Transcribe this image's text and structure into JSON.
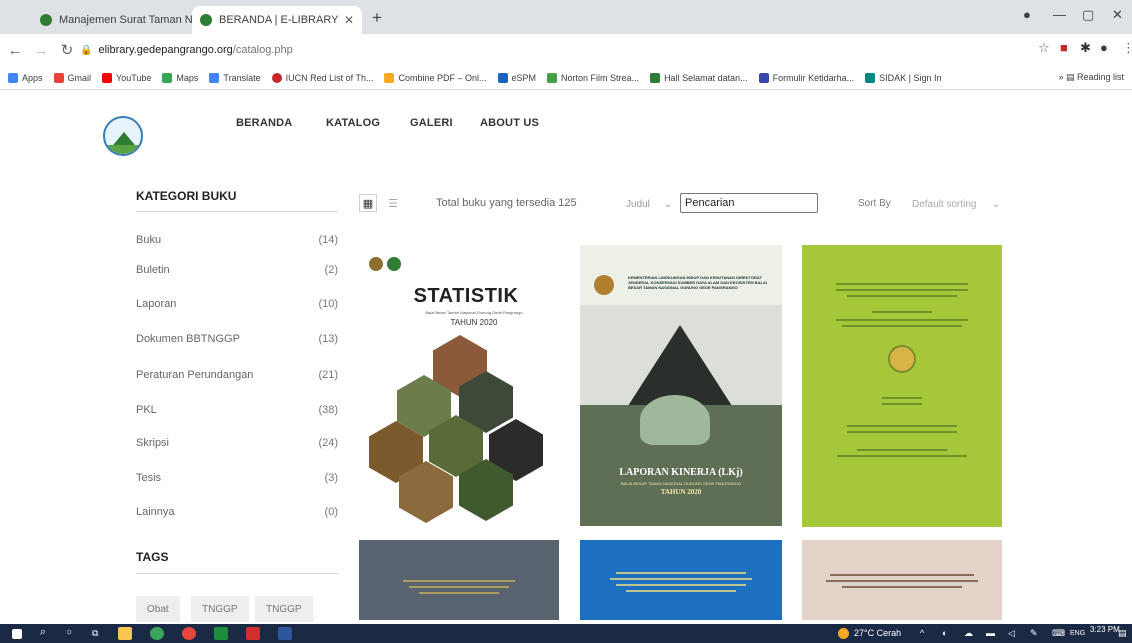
{
  "browser": {
    "tabs": [
      {
        "title": "Manajemen Surat Taman Nasior",
        "active": false
      },
      {
        "title": "BERANDA | E-LIBRARY",
        "active": true
      }
    ],
    "url_host": "elibrary.gedepangrango.org",
    "url_path": "/catalog.php",
    "bookmarks": [
      "Apps",
      "Gmail",
      "YouTube",
      "Maps",
      "Translate",
      "IUCN Red List of Th...",
      "Combine PDF – Onl...",
      "eSPM",
      "Norton Film Strea...",
      "Hall Selamat datan...",
      "Formulir Ketidarha...",
      "SIDAK | Sign In"
    ],
    "reading_list": "Reading list"
  },
  "site": {
    "nav": [
      "BERANDA",
      "KATALOG",
      "GALERI",
      "ABOUT US"
    ]
  },
  "sidebar": {
    "category_title": "KATEGORI BUKU",
    "categories": [
      {
        "name": "Buku",
        "count": "(14)"
      },
      {
        "name": "Buletin",
        "count": "(2)"
      },
      {
        "name": "Laporan",
        "count": "(10)"
      },
      {
        "name": "Dokumen BBTNGGP",
        "count": "(13)"
      },
      {
        "name": "Peraturan Perundangan",
        "count": "(21)"
      },
      {
        "name": "PKL",
        "count": "(38)"
      },
      {
        "name": "Skripsi",
        "count": "(24)"
      },
      {
        "name": "Tesis",
        "count": "(3)"
      },
      {
        "name": "Lainnya",
        "count": "(0)"
      }
    ],
    "tags_title": "TAGS",
    "tags": [
      "Obat",
      "TNGGP",
      "TNGGP"
    ]
  },
  "toolbar": {
    "total_text": "Total buku yang tersedia 125",
    "field_select": "Judul",
    "search_value": "Pencarian",
    "sort_label": "Sort By",
    "sort_select": "Default sorting"
  },
  "books": {
    "b1_title": "STATISTIK",
    "b1_subtitle": "Balai Besar Taman Nasional Gunung Gede Pangrango",
    "b1_year": "TAHUN 2020",
    "b2_header": "KEMENTERIAN LINGKUNGAN HIDUP DAN KEHUTANAN DIREKTORAT JENDERAL KONSERVASI SUMBER DAYA ALAM DAN EKOSISTEM BALAI BESAR TAMAN NASIONAL GUNUNG GEDE PANGRANGO",
    "b2_title": "LAPORAN KINERJA (LKj)",
    "b2_subtitle": "BALAI BESAR TAMAN NASIONAL GUNUNG GEDE PANGRANGO",
    "b2_year": "TAHUN 2020"
  },
  "taskbar": {
    "weather": "27°C Cerah",
    "lang": "ENG",
    "time": "3:23 PM"
  },
  "colors": {
    "taskbar_bg": "#1b2a44",
    "cover_green": "#a6c73a",
    "cover_blue": "#1c6fc1"
  }
}
